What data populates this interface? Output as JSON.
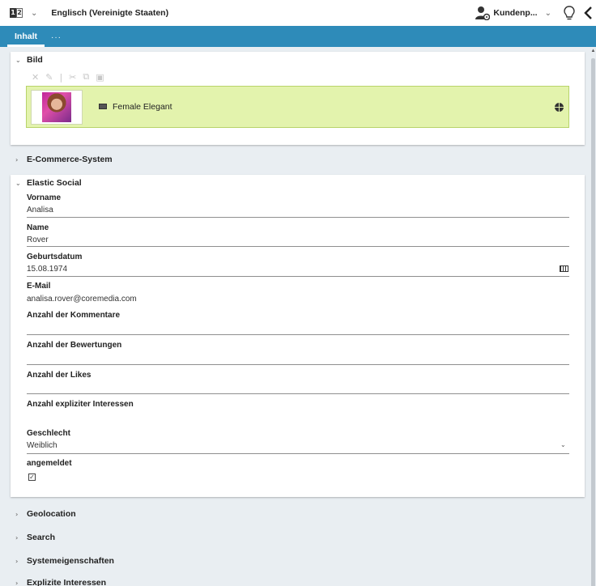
{
  "header": {
    "locale_label": "Englisch (Vereinigte Staaten)",
    "locale_icon_left": "1",
    "locale_icon_right": "2",
    "user_label": "Kundenp...",
    "icons": [
      "locale-icon",
      "chevron-down-icon",
      "user-settings-icon",
      "lightbulb-icon",
      "collapse-left-icon"
    ]
  },
  "tabs": {
    "active_label": "Inhalt",
    "more_label": "···"
  },
  "sections": {
    "bild": {
      "title": "Bild",
      "toolbar_icons": [
        "remove-icon",
        "edit-icon",
        "cut-icon",
        "copy-icon",
        "paste-icon"
      ],
      "linked_item": {
        "label": "Female Elegant"
      }
    },
    "ecommerce": {
      "title": "E-Commerce-System"
    },
    "elastic_social": {
      "title": "Elastic Social",
      "fields": {
        "vorname": {
          "label": "Vorname",
          "value": "Analisa"
        },
        "name": {
          "label": "Name",
          "value": "Rover"
        },
        "geburtsdatum": {
          "label": "Geburtsdatum",
          "value": "15.08.1974"
        },
        "email": {
          "label": "E-Mail",
          "value": "analisa.rover@coremedia.com"
        },
        "kommentare": {
          "label": "Anzahl der Kommentare",
          "value": ""
        },
        "bewertungen": {
          "label": "Anzahl der Bewertungen",
          "value": ""
        },
        "likes": {
          "label": "Anzahl der Likes",
          "value": ""
        },
        "interessen": {
          "label": "Anzahl expliziter Interessen",
          "value": ""
        },
        "geschlecht": {
          "label": "Geschlecht",
          "value": "Weiblich"
        },
        "angemeldet": {
          "label": "angemeldet",
          "checked": true
        }
      }
    },
    "geolocation": {
      "title": "Geolocation"
    },
    "search": {
      "title": "Search"
    },
    "systemeigenschaften": {
      "title": "Systemeigenschaften"
    },
    "explizite_interessen": {
      "title": "Explizite Interessen"
    }
  },
  "colors": {
    "accent": "#2e8bb9",
    "link_bg": "#e3f3ad",
    "page_bg": "#e9eef2"
  }
}
